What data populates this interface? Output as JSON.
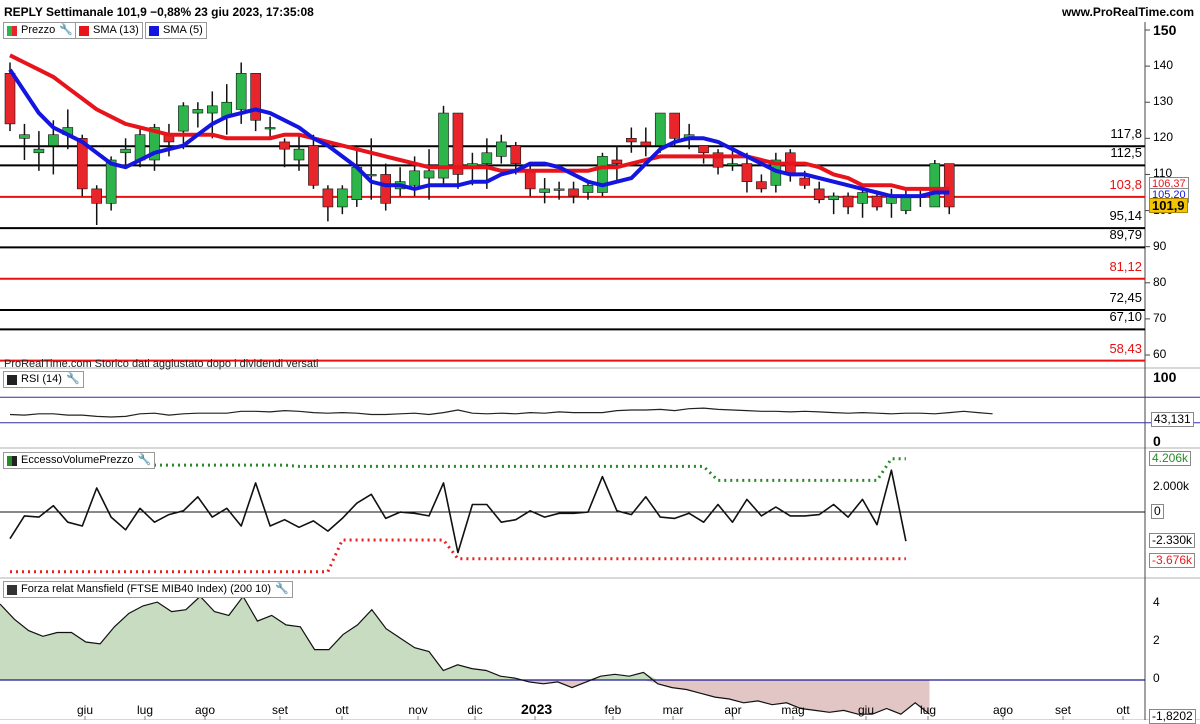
{
  "header": {
    "title": "REPLY Settimanale 101,9 −0,88% 23 giu 2023, 17:35:08",
    "site": "www.ProRealTime.com"
  },
  "legend": {
    "price": "Prezzo",
    "sma13": "SMA (13)",
    "sma5": "SMA (5)",
    "rsi": "RSI (14)",
    "volume": "EccessoVolumePrezzo",
    "mansfield": "Forza relat Mansfield (FTSE MIB40 Index) (200 10)"
  },
  "note": "ProRealTime.com Storico dati aggiustato dopo i dividendi versati",
  "colors": {
    "up": "#2db54b",
    "down": "#e8252a",
    "sma13": "#e8141c",
    "sma5": "#1515e0",
    "green_dots": "#2a8a2a",
    "red_dots": "#e82020"
  },
  "chart_data": [
    {
      "type": "candlestick",
      "title": "REPLY Settimanale",
      "x_ticks": [
        "giu",
        "lug",
        "ago",
        "set",
        "ott",
        "nov",
        "dic",
        "2023",
        "feb",
        "mar",
        "apr",
        "mag",
        "giu",
        "lug",
        "ago",
        "set",
        "ott"
      ],
      "y_ticks": [
        150,
        140,
        130,
        120,
        110,
        100,
        90,
        80,
        70,
        60
      ],
      "ylim": [
        57,
        152
      ],
      "last_price": "101,9",
      "sma13_value": "106,37",
      "sma5_value": "105,20",
      "candles": [
        {
          "o": 138,
          "c": 124,
          "h": 141,
          "l": 122
        },
        {
          "o": 120,
          "c": 121,
          "h": 124,
          "l": 114
        },
        {
          "o": 116,
          "c": 117,
          "h": 122,
          "l": 111
        },
        {
          "o": 118,
          "c": 121,
          "h": 125,
          "l": 110
        },
        {
          "o": 121,
          "c": 123,
          "h": 128,
          "l": 117
        },
        {
          "o": 120,
          "c": 106,
          "h": 121,
          "l": 104
        },
        {
          "o": 106,
          "c": 102,
          "h": 107,
          "l": 96
        },
        {
          "o": 102,
          "c": 114,
          "h": 115,
          "l": 100
        },
        {
          "o": 116,
          "c": 117,
          "h": 120,
          "l": 112
        },
        {
          "o": 114,
          "c": 121,
          "h": 123,
          "l": 112
        },
        {
          "o": 114,
          "c": 123,
          "h": 124,
          "l": 111
        },
        {
          "o": 121,
          "c": 119,
          "h": 124,
          "l": 115
        },
        {
          "o": 122,
          "c": 129,
          "h": 130,
          "l": 117
        },
        {
          "o": 127,
          "c": 128,
          "h": 130,
          "l": 123
        },
        {
          "o": 127,
          "c": 129,
          "h": 133,
          "l": 120
        },
        {
          "o": 126,
          "c": 130,
          "h": 135,
          "l": 121
        },
        {
          "o": 128,
          "c": 138,
          "h": 141,
          "l": 124
        },
        {
          "o": 138,
          "c": 125,
          "h": 138,
          "l": 122
        },
        {
          "o": 123,
          "c": 123,
          "h": 126,
          "l": 120
        },
        {
          "o": 119,
          "c": 117,
          "h": 120,
          "l": 112
        },
        {
          "o": 114,
          "c": 117,
          "h": 121,
          "l": 111
        },
        {
          "o": 118,
          "c": 107,
          "h": 121,
          "l": 106
        },
        {
          "o": 106,
          "c": 101,
          "h": 107,
          "l": 97
        },
        {
          "o": 101,
          "c": 106,
          "h": 107,
          "l": 99
        },
        {
          "o": 103,
          "c": 112,
          "h": 117,
          "l": 101
        },
        {
          "o": 110,
          "c": 110,
          "h": 120,
          "l": 103
        },
        {
          "o": 110,
          "c": 102,
          "h": 113,
          "l": 100
        },
        {
          "o": 106,
          "c": 108,
          "h": 112,
          "l": 104
        },
        {
          "o": 107,
          "c": 111,
          "h": 115,
          "l": 104
        },
        {
          "o": 109,
          "c": 111,
          "h": 117,
          "l": 103
        },
        {
          "o": 109,
          "c": 127,
          "h": 129,
          "l": 107
        },
        {
          "o": 127,
          "c": 110,
          "h": 127,
          "l": 106
        },
        {
          "o": 112,
          "c": 113,
          "h": 116,
          "l": 107
        },
        {
          "o": 113,
          "c": 116,
          "h": 120,
          "l": 106
        },
        {
          "o": 115,
          "c": 119,
          "h": 121,
          "l": 113
        },
        {
          "o": 118,
          "c": 113,
          "h": 119,
          "l": 110
        },
        {
          "o": 111,
          "c": 106,
          "h": 113,
          "l": 104
        },
        {
          "o": 105,
          "c": 106,
          "h": 109,
          "l": 102
        },
        {
          "o": 106,
          "c": 106,
          "h": 108,
          "l": 103
        },
        {
          "o": 106,
          "c": 104,
          "h": 108,
          "l": 102
        },
        {
          "o": 105,
          "c": 107,
          "h": 108,
          "l": 103
        },
        {
          "o": 105,
          "c": 115,
          "h": 116,
          "l": 104
        },
        {
          "o": 114,
          "c": 113,
          "h": 118,
          "l": 108
        },
        {
          "o": 120,
          "c": 119,
          "h": 123,
          "l": 116
        },
        {
          "o": 119,
          "c": 118,
          "h": 123,
          "l": 115
        },
        {
          "o": 118,
          "c": 127,
          "h": 127,
          "l": 116
        },
        {
          "o": 127,
          "c": 120,
          "h": 127,
          "l": 118
        },
        {
          "o": 120,
          "c": 121,
          "h": 124,
          "l": 117
        },
        {
          "o": 118,
          "c": 116,
          "h": 118,
          "l": 113
        },
        {
          "o": 116,
          "c": 112,
          "h": 117,
          "l": 110
        },
        {
          "o": 113,
          "c": 113,
          "h": 118,
          "l": 111
        },
        {
          "o": 113,
          "c": 108,
          "h": 116,
          "l": 105
        },
        {
          "o": 108,
          "c": 106,
          "h": 110,
          "l": 105
        },
        {
          "o": 107,
          "c": 114,
          "h": 116,
          "l": 105
        },
        {
          "o": 116,
          "c": 110,
          "h": 117,
          "l": 108
        },
        {
          "o": 109,
          "c": 107,
          "h": 111,
          "l": 106
        },
        {
          "o": 106,
          "c": 103,
          "h": 108,
          "l": 102
        },
        {
          "o": 103,
          "c": 104,
          "h": 105,
          "l": 99
        },
        {
          "o": 104,
          "c": 101,
          "h": 105,
          "l": 99
        },
        {
          "o": 102,
          "c": 105,
          "h": 106,
          "l": 98
        },
        {
          "o": 104,
          "c": 101,
          "h": 105,
          "l": 100
        },
        {
          "o": 102,
          "c": 104,
          "h": 106,
          "l": 98
        },
        {
          "o": 100,
          "c": 104,
          "h": 106,
          "l": 99
        },
        {
          "o": 104,
          "c": 104,
          "h": 106,
          "l": 101
        },
        {
          "o": 101,
          "c": 113,
          "h": 114,
          "l": 101
        },
        {
          "o": 113,
          "c": 101,
          "h": 113,
          "l": 99
        }
      ],
      "sma13": [
        143,
        141,
        139,
        137,
        134,
        131,
        128,
        126,
        124,
        123,
        122,
        121,
        121,
        121,
        121,
        120,
        120,
        120,
        120,
        121,
        121,
        120,
        119,
        118,
        117,
        116,
        115,
        114,
        113,
        112,
        112,
        112,
        112,
        112,
        111,
        111,
        111,
        111,
        111,
        111,
        111,
        112,
        112,
        113,
        114,
        115,
        115,
        115,
        115,
        115,
        115,
        115,
        114,
        113,
        113,
        113,
        112,
        110,
        109,
        107,
        107,
        107,
        106,
        106,
        106,
        106
      ],
      "sma5": [
        139,
        133,
        127,
        123,
        121,
        119,
        116,
        113,
        112,
        114,
        116,
        117,
        118,
        121,
        124,
        126,
        127,
        128,
        127,
        125,
        123,
        120,
        118,
        115,
        112,
        108,
        107,
        107,
        106,
        107,
        107,
        107,
        108,
        108,
        110,
        111,
        113,
        113,
        112,
        110,
        108,
        107,
        108,
        109,
        113,
        117,
        119,
        120,
        120,
        119,
        117,
        115,
        113,
        111,
        110,
        110,
        109,
        108,
        107,
        106,
        105,
        104,
        104,
        104,
        105,
        105
      ]
    },
    {
      "type": "line",
      "title": "RSI (14)",
      "y_ticks": [
        100,
        0
      ],
      "ylim": [
        0,
        100
      ],
      "levels": [
        70,
        30
      ],
      "last_value": "43,131",
      "values": [
        43,
        42,
        44,
        44,
        42,
        42,
        40,
        39,
        40,
        44,
        45,
        42,
        44,
        45,
        45,
        45,
        48,
        48,
        47,
        49,
        48,
        46,
        45,
        46,
        45,
        43,
        43,
        44,
        45,
        43,
        46,
        50,
        45,
        44,
        45,
        44,
        46,
        45,
        47,
        46,
        46,
        46,
        49,
        50,
        50,
        51,
        49,
        52,
        53,
        51,
        50,
        49,
        48,
        48,
        47,
        48,
        47,
        46,
        45,
        46,
        45,
        44,
        45,
        45,
        44,
        46,
        48,
        46,
        44
      ]
    },
    {
      "type": "line",
      "title": "EccessoVolumePrezzo",
      "y_ticks": [
        "2.000k",
        "0"
      ],
      "ylim": [
        -5200,
        4500
      ],
      "upper_value": "4.206k",
      "last_value": "-2.330k",
      "lower_value": "-3.676k",
      "values": [
        -2100,
        -300,
        -400,
        500,
        -800,
        -1100,
        1900,
        -400,
        -1400,
        300,
        -800,
        -200,
        100,
        1200,
        -400,
        300,
        -1100,
        2300,
        -1100,
        -600,
        -1200,
        -700,
        -1500,
        -500,
        700,
        1400,
        -500,
        0,
        -100,
        -300,
        2300,
        -3200,
        600,
        600,
        -800,
        -600,
        100,
        -400,
        -100,
        -100,
        0,
        2800,
        100,
        -200,
        1200,
        -400,
        -500,
        -100,
        -800,
        600,
        -800,
        1000,
        -300,
        400,
        -300,
        -300,
        -200,
        600,
        -400,
        1000,
        -1000,
        3300,
        -2300
      ],
      "upper_dots": [
        3700,
        3700,
        3700,
        3700,
        3700,
        3700,
        3700,
        3700,
        3700,
        3700,
        3700,
        3700,
        3700,
        3700,
        3700,
        3700,
        3700,
        3700,
        3700,
        3700,
        3600,
        3600,
        3600,
        3600,
        3600,
        3600,
        3600,
        3600,
        3600,
        3600,
        3600,
        3600,
        3600,
        3600,
        3600,
        3600,
        3600,
        3600,
        3600,
        3600,
        3600,
        3600,
        3600,
        3600,
        3600,
        3600,
        3600,
        3600,
        3600,
        2500,
        2500,
        2500,
        2500,
        2500,
        2500,
        2500,
        2500,
        2500,
        2500,
        2500,
        2500,
        4206,
        4206
      ],
      "lower_dots": [
        -4700,
        -4700,
        -4700,
        -4700,
        -4700,
        -4700,
        -4700,
        -4700,
        -4700,
        -4700,
        -4700,
        -4700,
        -4700,
        -4700,
        -4700,
        -4700,
        -4700,
        -4700,
        -4700,
        -4700,
        -4700,
        -4700,
        -4700,
        -2200,
        -2200,
        -2200,
        -2200,
        -2200,
        -2200,
        -2200,
        -2200,
        -3676,
        -3676,
        -3676,
        -3676,
        -3676,
        -3676,
        -3676,
        -3676,
        -3676,
        -3676,
        -3676,
        -3676,
        -3676,
        -3676,
        -3676,
        -3676,
        -3676,
        -3676,
        -3676,
        -3676,
        -3676,
        -3676,
        -3676,
        -3676,
        -3676,
        -3676,
        -3676,
        -3676,
        -3676,
        -3676,
        -3676,
        -3676
      ]
    },
    {
      "type": "area",
      "title": "Forza relat Mansfield (FTSE MIB40 Index) (200 10)",
      "y_ticks": [
        4,
        2,
        0
      ],
      "ylim": [
        -2,
        5
      ],
      "last_value": "-1,8202",
      "values": [
        4.0,
        3.2,
        2.6,
        2.3,
        2.5,
        2.5,
        2.0,
        1.9,
        2.8,
        3.5,
        3.9,
        4.1,
        3.6,
        3.7,
        4.4,
        3.6,
        3.4,
        4.4,
        3.1,
        3.4,
        2.9,
        2.8,
        1.6,
        1.6,
        2.4,
        2.9,
        3.7,
        2.7,
        2.2,
        1.7,
        1.5,
        0.5,
        0.8,
        0.6,
        0.5,
        0.2,
        0.1,
        -0.1,
        -0.2,
        -0.1,
        -0.4,
        -0.1,
        0.2,
        0.3,
        0.2,
        0.4,
        -0.2,
        -0.4,
        -0.5,
        -0.7,
        -0.9,
        -1.0,
        -1.2,
        -1.1,
        -1.3,
        -1.2,
        -1.5,
        -1.6,
        -1.7,
        -1.6,
        -1.8,
        -1.8,
        -1.5,
        -1.8,
        -1.2,
        -1.8
      ]
    }
  ],
  "levels": [
    {
      "value": 117.8,
      "label": "117,8",
      "color": "#000"
    },
    {
      "value": 112.5,
      "label": "112,5",
      "color": "#000"
    },
    {
      "value": 103.8,
      "label": "103,8",
      "color": "#e81010"
    },
    {
      "value": 95.14,
      "label": "95,14",
      "color": "#000"
    },
    {
      "value": 89.79,
      "label": "89,79",
      "color": "#000"
    },
    {
      "value": 81.12,
      "label": "81,12",
      "color": "#e81010"
    },
    {
      "value": 72.45,
      "label": "72,45",
      "color": "#000"
    },
    {
      "value": 67.1,
      "label": "67,10",
      "color": "#000"
    },
    {
      "value": 58.43,
      "label": "58,43",
      "color": "#e81010"
    }
  ]
}
